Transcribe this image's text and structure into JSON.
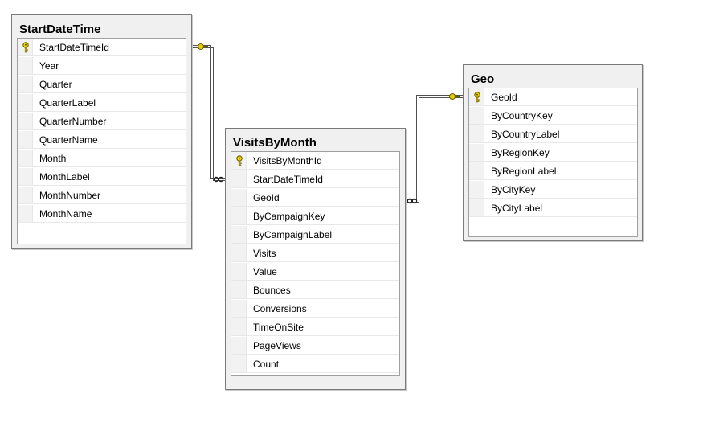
{
  "tables": {
    "startdatetime": {
      "title": "StartDateTime",
      "columns": [
        {
          "name": "StartDateTimeId",
          "key": true
        },
        {
          "name": "Year"
        },
        {
          "name": "Quarter"
        },
        {
          "name": "QuarterLabel"
        },
        {
          "name": "QuarterNumber"
        },
        {
          "name": "QuarterName"
        },
        {
          "name": "Month"
        },
        {
          "name": "MonthLabel"
        },
        {
          "name": "MonthNumber"
        },
        {
          "name": "MonthName"
        }
      ]
    },
    "visitsbymonth": {
      "title": "VisitsByMonth",
      "columns": [
        {
          "name": "VisitsByMonthId",
          "key": true
        },
        {
          "name": "StartDateTimeId"
        },
        {
          "name": "GeoId"
        },
        {
          "name": "ByCampaignKey"
        },
        {
          "name": "ByCampaignLabel"
        },
        {
          "name": "Visits"
        },
        {
          "name": "Value"
        },
        {
          "name": "Bounces"
        },
        {
          "name": "Conversions"
        },
        {
          "name": "TimeOnSite"
        },
        {
          "name": "PageViews"
        },
        {
          "name": "Count"
        }
      ]
    },
    "geo": {
      "title": "Geo",
      "columns": [
        {
          "name": "GeoId",
          "key": true
        },
        {
          "name": "ByCountryKey"
        },
        {
          "name": "ByCountryLabel"
        },
        {
          "name": "ByRegionKey"
        },
        {
          "name": "ByRegionLabel"
        },
        {
          "name": "ByCityKey"
        },
        {
          "name": "ByCityLabel"
        }
      ]
    }
  },
  "relationships": [
    {
      "from": "startdatetime",
      "from_end": "one",
      "to": "visitsbymonth",
      "to_end": "many"
    },
    {
      "from": "geo",
      "from_end": "one",
      "to": "visitsbymonth",
      "to_end": "many"
    }
  ],
  "icons": {
    "key": "key-icon",
    "one_end": "key-icon",
    "many_end": "infinity-icon"
  },
  "colors": {
    "key_icon": "#e8d000",
    "line": "#505050",
    "panel": "#f0f0f0"
  }
}
